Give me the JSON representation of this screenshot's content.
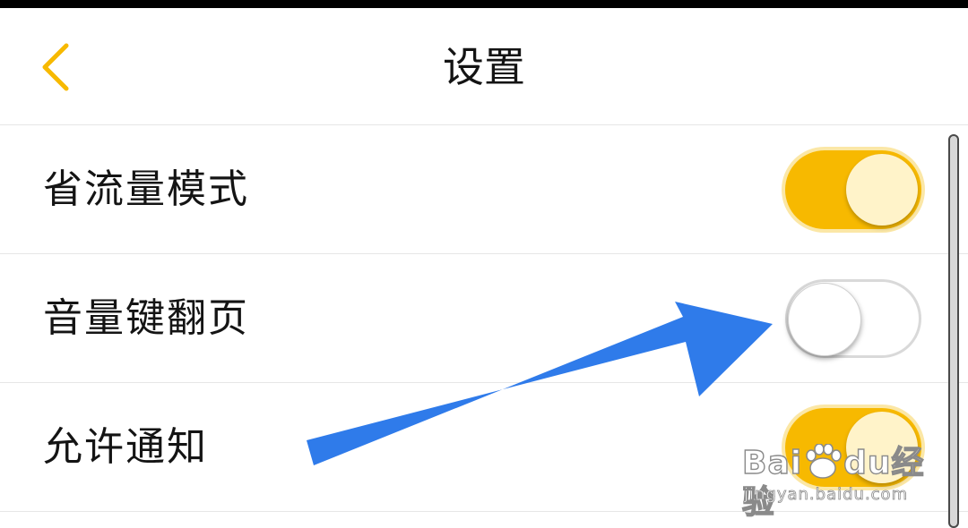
{
  "header": {
    "title": "设置",
    "back_icon": "chevron-left-icon"
  },
  "colors": {
    "accent": "#f7b900",
    "knob_on": "#fff3c9",
    "annotation_arrow": "#2f7bea"
  },
  "settings": [
    {
      "label": "省流量模式",
      "enabled": true
    },
    {
      "label": "音量键翻页",
      "enabled": false
    },
    {
      "label": "允许通知",
      "enabled": true
    }
  ],
  "watermark": {
    "logo_text_left": "Bai",
    "logo_text_right": "经验",
    "logo_du": "du",
    "url": "jingyan.baidu.com"
  }
}
